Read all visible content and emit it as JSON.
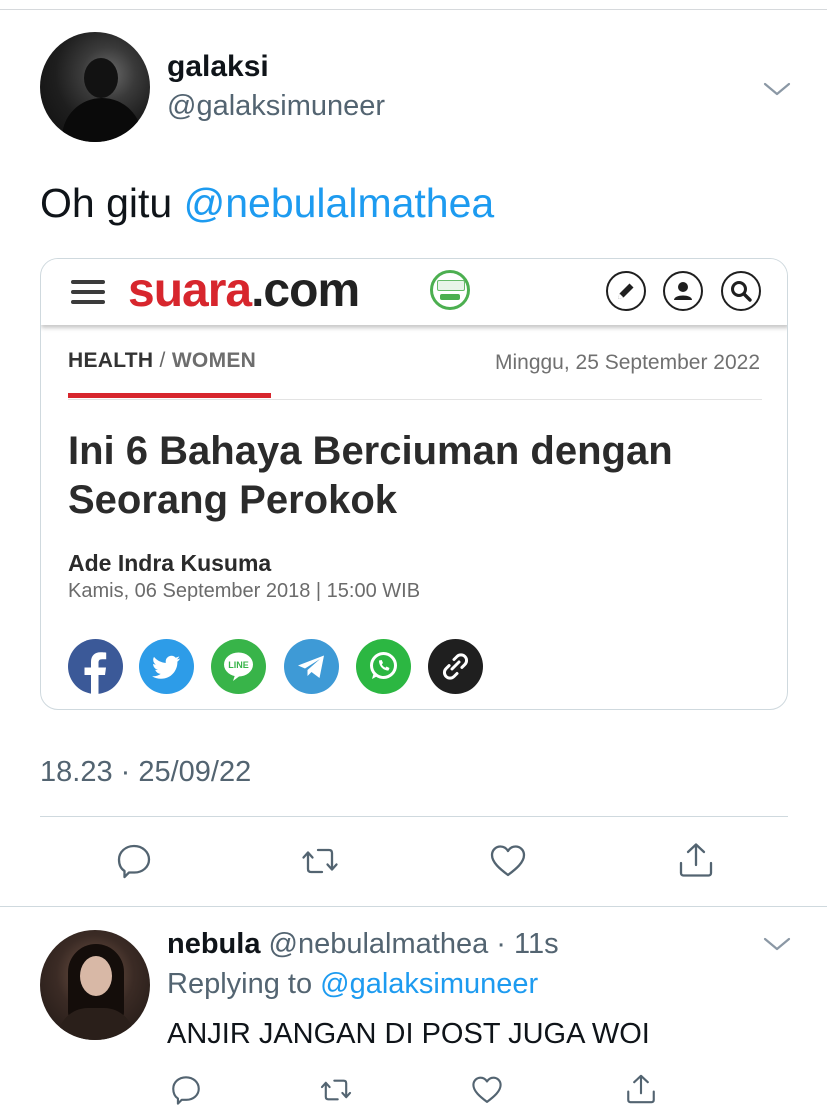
{
  "main_tweet": {
    "name": "galaksi",
    "handle": "@galaksimuneer",
    "text": "Oh gitu ",
    "mention": "@nebulalmathea",
    "timestamp": "18.23 · 25/09/22"
  },
  "card": {
    "logo_part1": "suara",
    "logo_part2": ".com",
    "category": "HEALTH",
    "category_sep": " / ",
    "subcategory": "WOMEN",
    "header_date": "Minggu, 25 September 2022",
    "headline": "Ini 6 Bahaya Berciuman dengan Seorang Perokok",
    "author": "Ade Indra Kusuma",
    "published": "Kamis, 06 September 2018 | 15:00 WIB",
    "share_icons": [
      "facebook-icon",
      "twitter-icon",
      "line-icon",
      "telegram-icon",
      "whatsapp-icon",
      "link-icon"
    ],
    "line_label": "LINE"
  },
  "reply_tweet": {
    "name": "nebula",
    "handle": "@nebulalmathea · 11s",
    "replying_prefix": "Replying to ",
    "replying_to": "@galaksimuneer",
    "text": "ANJIR JANGAN DI POST JUGA WOI"
  },
  "colors": {
    "mention": "#1d9bf0",
    "muted": "#536471",
    "suara_red": "#d7262d"
  }
}
